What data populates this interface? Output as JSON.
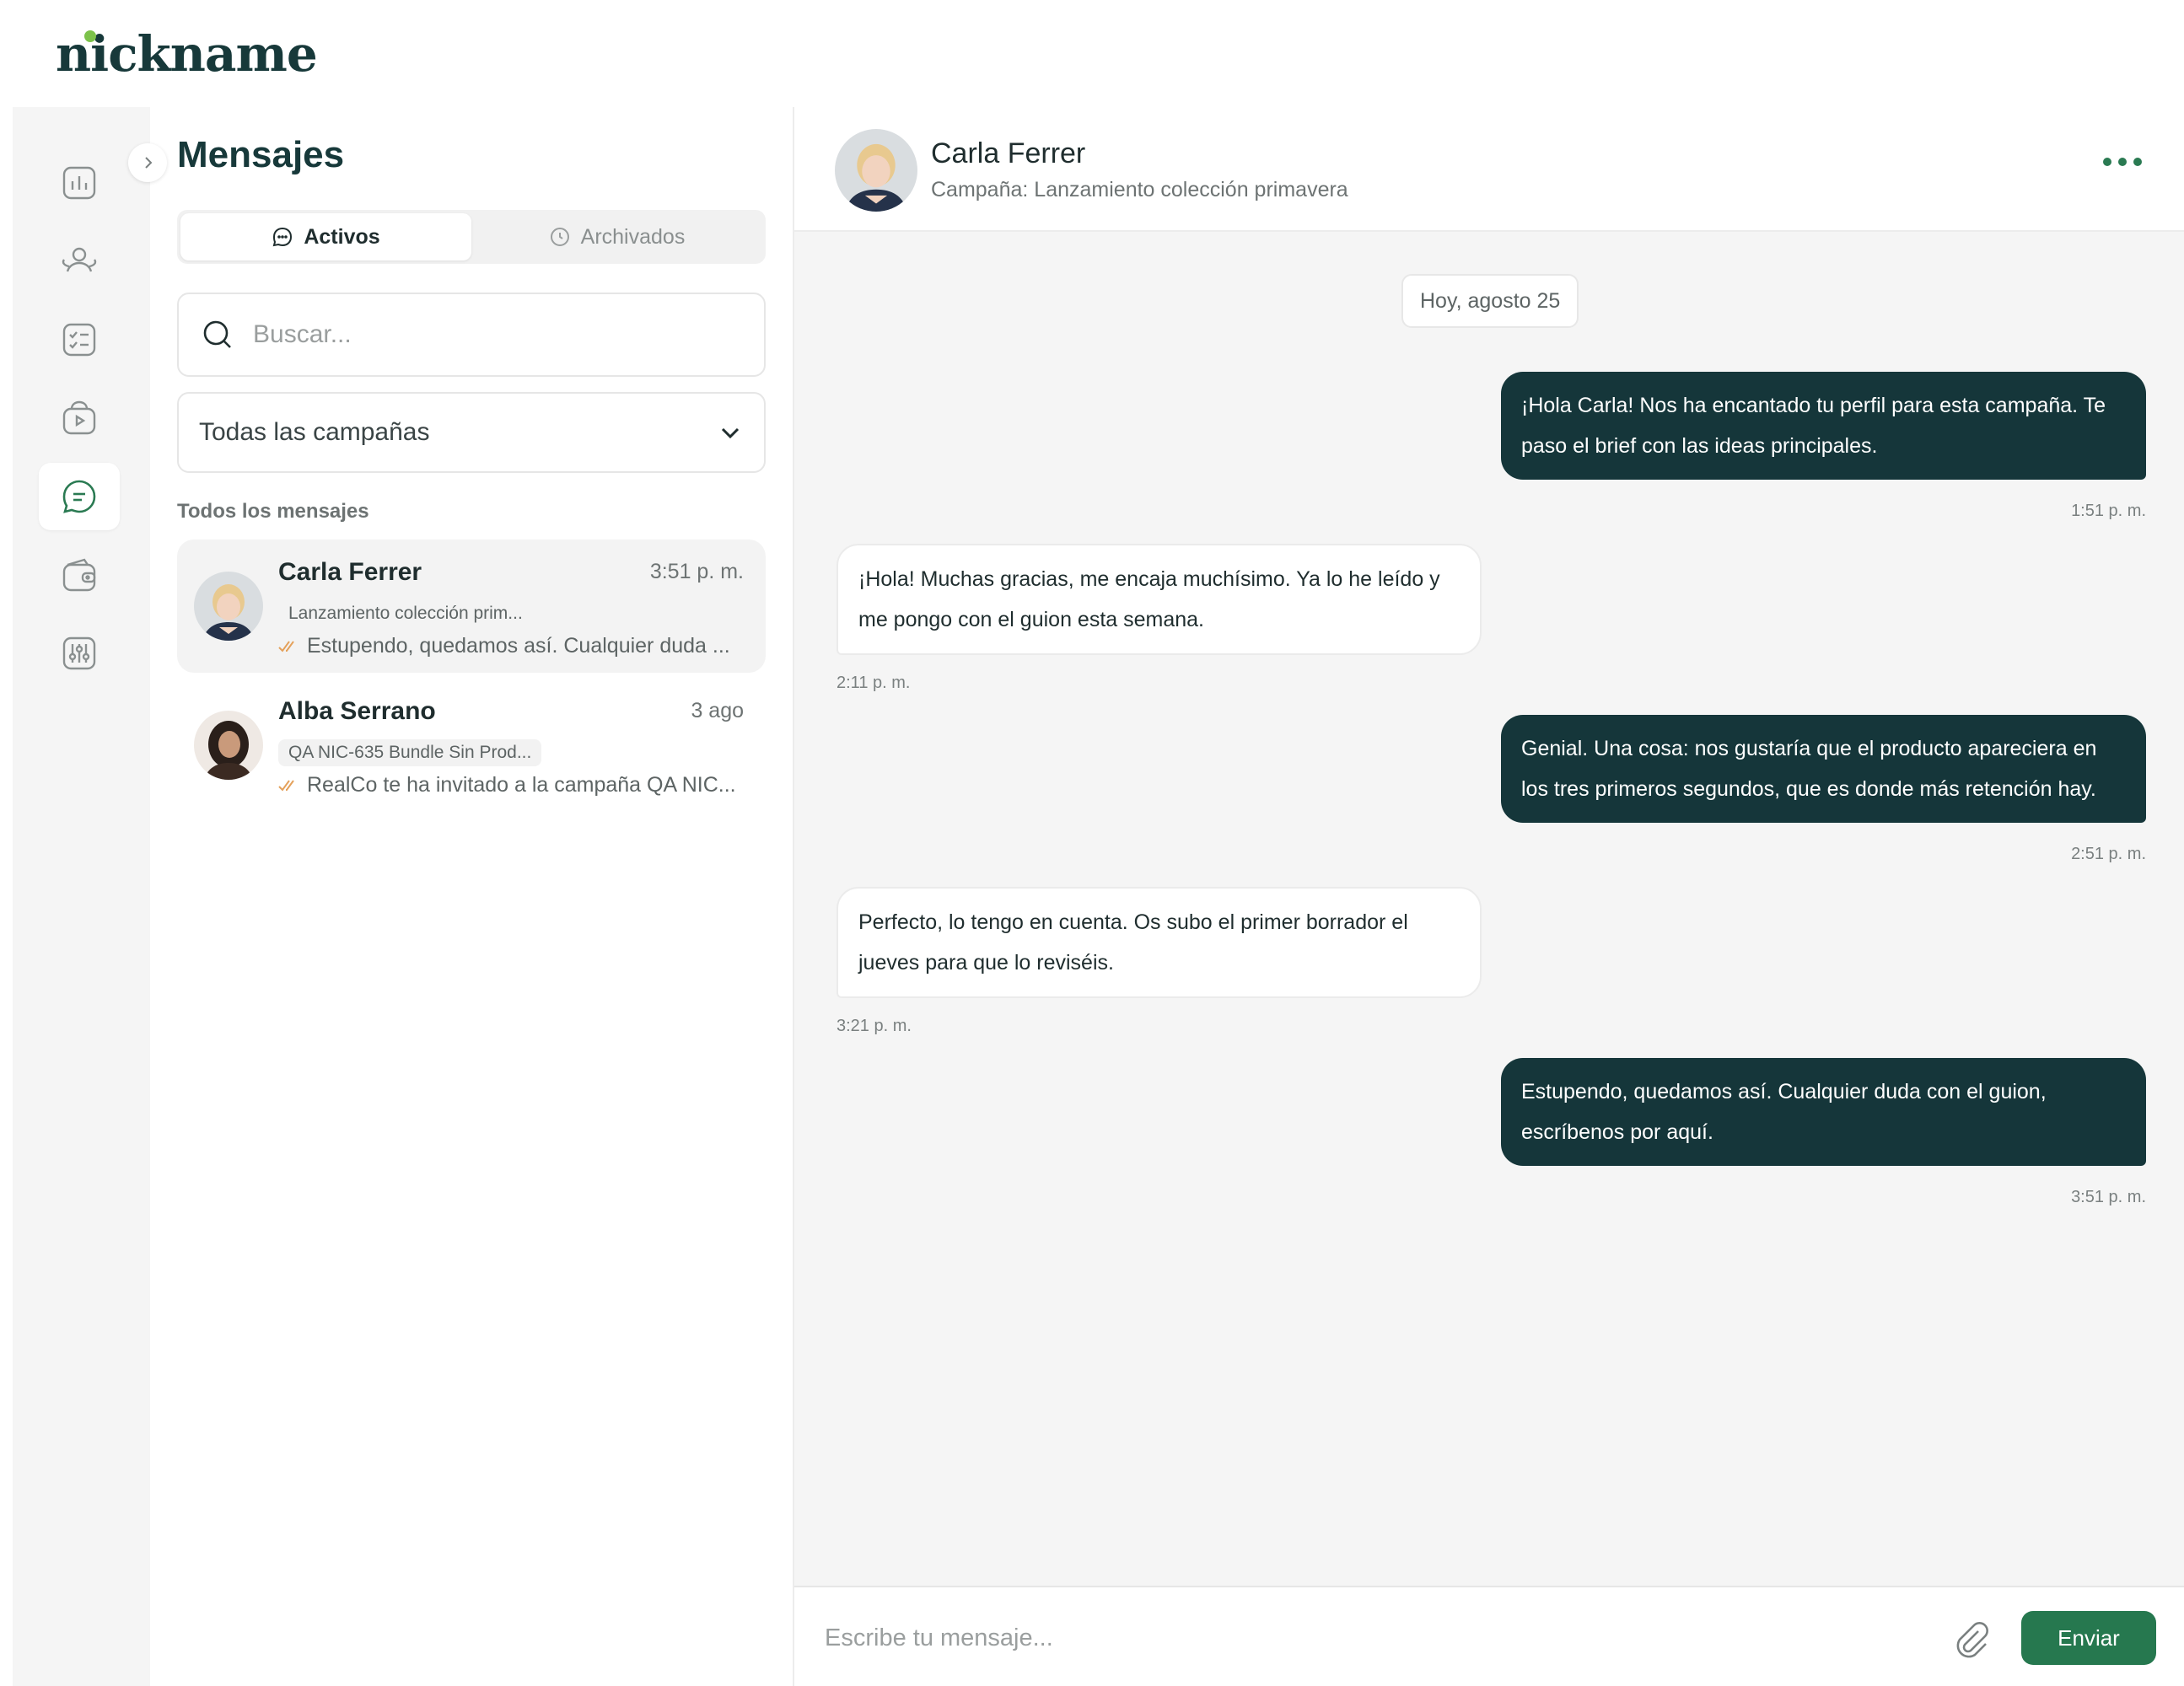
{
  "brand": {
    "logo": "nickname"
  },
  "rail": {
    "items": [
      {
        "name": "analytics-icon",
        "active": false
      },
      {
        "name": "users-icon",
        "active": false
      },
      {
        "name": "checklist-icon",
        "active": false
      },
      {
        "name": "video-bag-icon",
        "active": false
      },
      {
        "name": "chat-icon",
        "active": true
      },
      {
        "name": "wallet-icon",
        "active": false
      },
      {
        "name": "sliders-icon",
        "active": false
      }
    ],
    "accent": "#2a7a52"
  },
  "list": {
    "title": "Mensajes",
    "tabs": [
      {
        "label": "Activos",
        "active": true
      },
      {
        "label": "Archivados",
        "active": false
      }
    ],
    "search_placeholder": "Buscar...",
    "campaign_filter": "Todas las campañas",
    "section_label": "Todos los mensajes",
    "conversations": [
      {
        "name": "Carla Ferrer",
        "time": "3:51 p. m.",
        "tag": "Lanzamiento colección prim...",
        "preview": "Estupendo, quedamos así. Cualquier duda ...",
        "active": true
      },
      {
        "name": "Alba Serrano",
        "time": "3 ago",
        "tag": "QA NIC-635 Bundle Sin Prod...",
        "preview": "RealCo te ha invitado a la campaña QA NIC...",
        "active": false
      }
    ]
  },
  "chat": {
    "contact_name": "Carla Ferrer",
    "campaign": "Campaña: Lanzamiento colección primavera",
    "date_label": "Hoy, agosto 25",
    "messages": [
      {
        "dir": "out",
        "text": "¡Hola Carla! Nos ha encantado tu perfil para esta campaña. Te paso el brief con las ideas principales.",
        "time": "1:51 p. m."
      },
      {
        "dir": "in",
        "text": "¡Hola! Muchas gracias, me encaja muchísimo. Ya lo he leído y me pongo con el guion esta semana.",
        "time": "2:11 p. m."
      },
      {
        "dir": "out",
        "text": "Genial. Una cosa: nos gustaría que el producto apareciera en los tres primeros segundos, que es donde más retención hay.",
        "time": "2:51 p. m."
      },
      {
        "dir": "in",
        "text": "Perfecto, lo tengo en cuenta. Os subo el primer borrador el jueves para que lo reviséis.",
        "time": "3:21 p. m."
      },
      {
        "dir": "out",
        "text": "Estupendo, quedamos así. Cualquier duda con el guion, escríbenos por aquí.",
        "time": "3:51 p. m."
      }
    ],
    "composer_placeholder": "Escribe tu mensaje...",
    "send_label": "Enviar"
  },
  "colors": {
    "brand_dark": "#15363a",
    "send_green": "#26784f",
    "logo_dot": "#7cc24a"
  }
}
